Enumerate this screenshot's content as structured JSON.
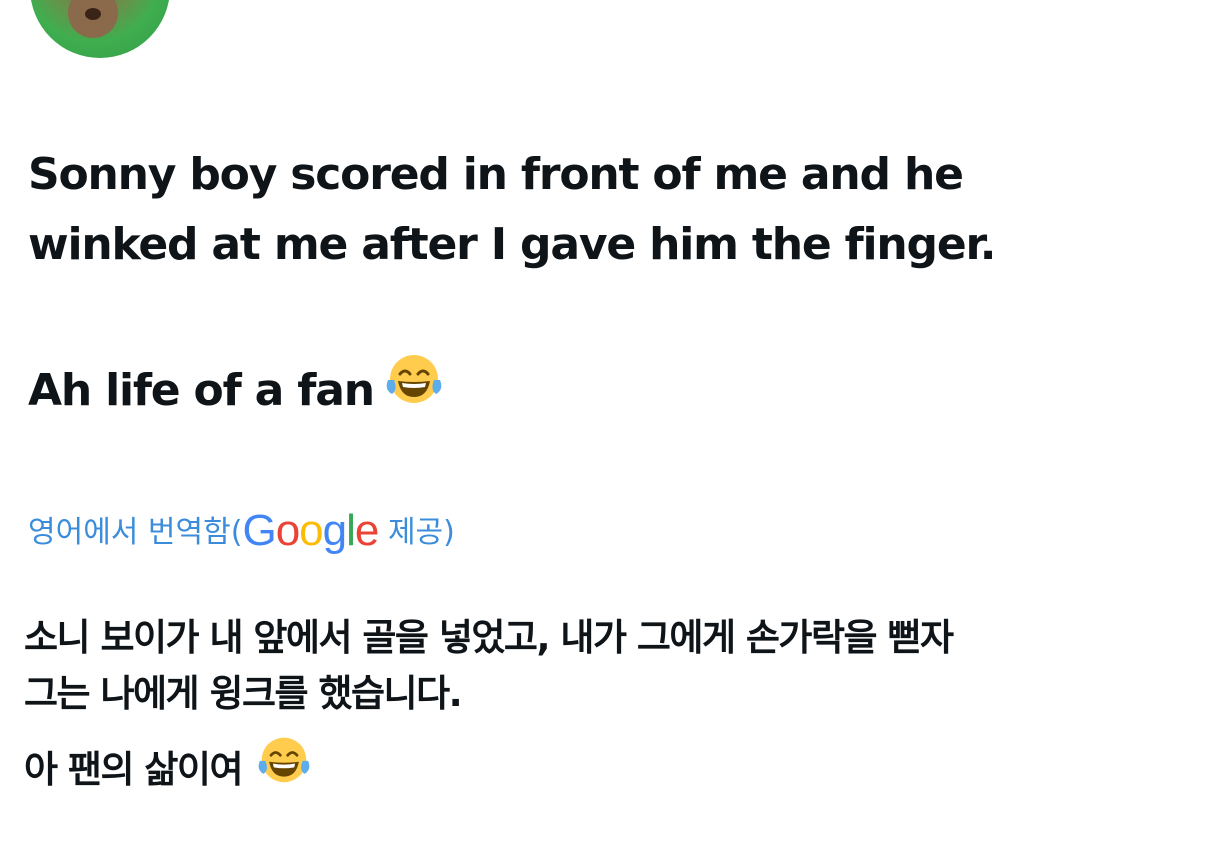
{
  "tweet": {
    "lines": [
      "Sonny boy scored in front of me and he",
      "winked at me after I gave him the finger.",
      "Ah life of a fan"
    ],
    "emoji": "face-with-tears-of-joy"
  },
  "translation": {
    "label_prefix": "영어에서 번역함(",
    "provider_letters": [
      "G",
      "o",
      "o",
      "g",
      "l",
      "e"
    ],
    "label_suffix": " 제공)",
    "lines": [
      "소니 보이가 내 앞에서 골을 넣었고, 내가 그에게 손가락을 뻗자",
      "그는 나에게 윙크를 했습니다.",
      "아 팬의 삶이여"
    ],
    "link_color": "#3b8ddb"
  }
}
